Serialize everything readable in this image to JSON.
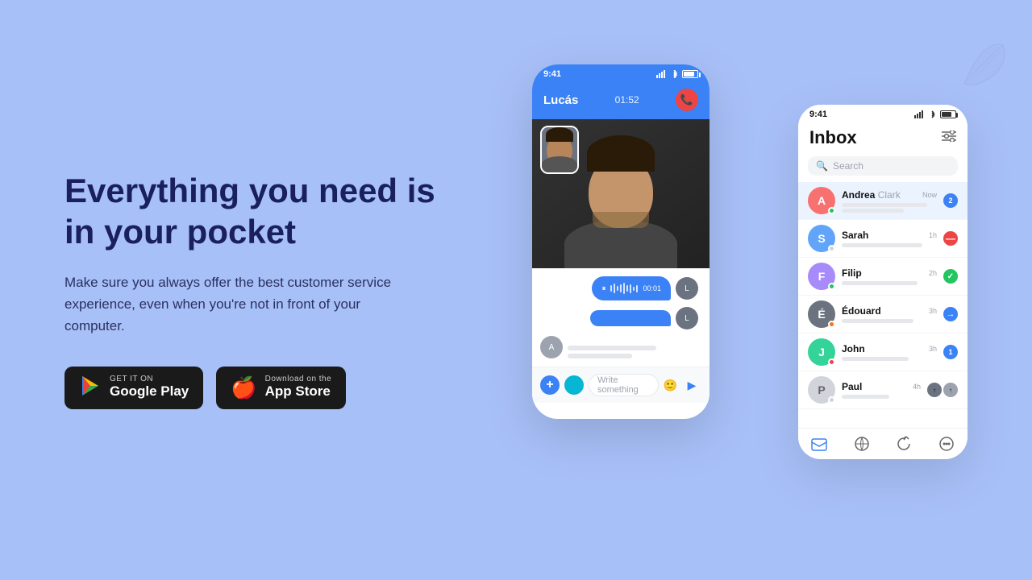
{
  "background_color": "#a8c0f8",
  "headline": "Everything you need is in your pocket",
  "subtext": "Make sure you always offer the best customer service experience, even when you're not in front of your computer.",
  "cta_buttons": {
    "google_play": {
      "small_text": "GET IT ON",
      "large_text": "Google Play"
    },
    "app_store": {
      "small_text": "Download on the",
      "large_text": "App Store"
    }
  },
  "phone_video": {
    "status_time": "9:41",
    "caller_name": "Lucás",
    "call_timer": "01:52",
    "input_placeholder": "Write something"
  },
  "phone_inbox": {
    "status_time": "9:41",
    "title": "Inbox",
    "search_placeholder": "Search",
    "contacts": [
      {
        "name": "Andrea",
        "subname": "Clark",
        "online": true,
        "badge": "2",
        "badge_type": "blue",
        "time": "Now"
      },
      {
        "name": "Sarah",
        "online": false,
        "badge": "—",
        "badge_type": "red",
        "time": "1h"
      },
      {
        "name": "Filip",
        "online": true,
        "badge": "✓",
        "badge_type": "green",
        "time": "2h"
      },
      {
        "name": "Édouard",
        "online": false,
        "badge": "→",
        "badge_type": "blue-arrow",
        "time": "3h"
      },
      {
        "name": "John",
        "online": false,
        "badge": "1",
        "badge_type": "blue",
        "time": "3h"
      },
      {
        "name": "Paul",
        "online": false,
        "badge": "",
        "badge_type": "none",
        "time": "4h"
      }
    ]
  }
}
